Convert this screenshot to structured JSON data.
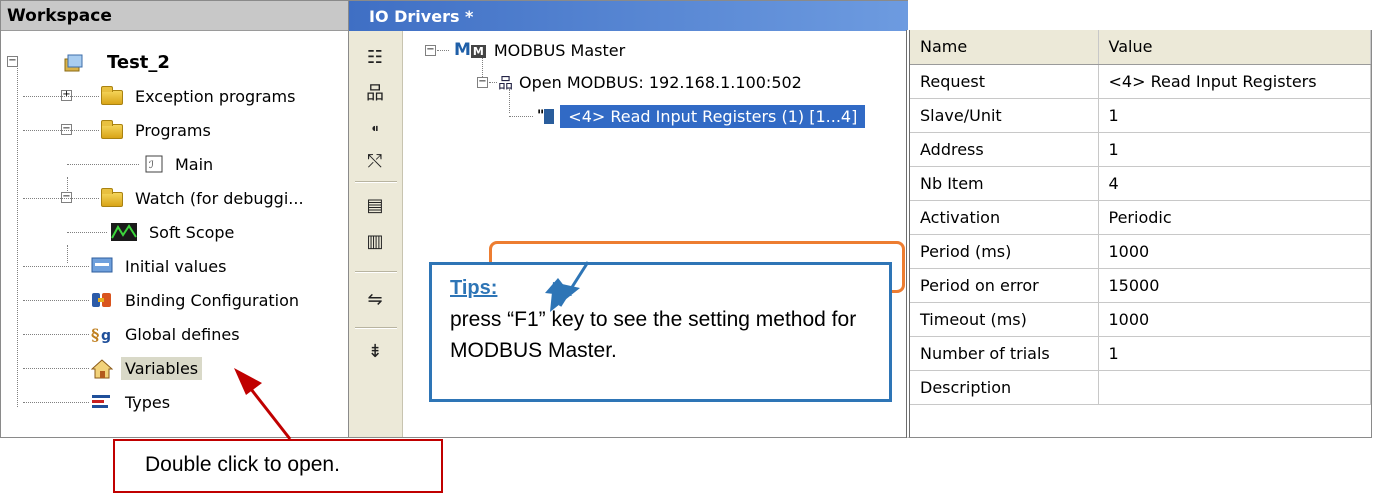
{
  "workspace": {
    "title": "Workspace",
    "project": "Test_2",
    "items": [
      {
        "label": "Exception programs",
        "icon": "folder-icon"
      },
      {
        "label": "Programs",
        "icon": "folder-icon"
      },
      {
        "label": "Main",
        "icon": "program-icon"
      },
      {
        "label": "Watch (for debuggi...",
        "icon": "folder-icon"
      },
      {
        "label": "Soft Scope",
        "icon": "scope-icon"
      },
      {
        "label": "Initial values",
        "icon": "initial-values-icon"
      },
      {
        "label": "Binding Configuration",
        "icon": "binding-icon"
      },
      {
        "label": "Global defines",
        "icon": "defines-icon"
      },
      {
        "label": "Variables",
        "icon": "house-icon"
      },
      {
        "label": "Types",
        "icon": "types-icon"
      }
    ]
  },
  "io": {
    "title": "IO Drivers *",
    "master": "MODBUS Master",
    "open": "Open MODBUS: 192.168.1.100:502",
    "request": "<4> Read Input Registers (1) [1...4]"
  },
  "props": {
    "header_name": "Name",
    "header_value": "Value",
    "rows": [
      {
        "name": "Request",
        "value": "<4> Read Input Registers"
      },
      {
        "name": "Slave/Unit",
        "value": "1"
      },
      {
        "name": "Address",
        "value": "1"
      },
      {
        "name": "Nb Item",
        "value": "4"
      },
      {
        "name": "Activation",
        "value": "Periodic"
      },
      {
        "name": "Period (ms)",
        "value": "1000"
      },
      {
        "name": "Period on error",
        "value": "15000"
      },
      {
        "name": "Timeout (ms)",
        "value": "1000"
      },
      {
        "name": "Number of trials",
        "value": "1"
      },
      {
        "name": "Description",
        "value": ""
      }
    ]
  },
  "callouts": {
    "tips_title": "Tips:",
    "tips_body": "press “F1” key to see the setting method for MODBUS Master.",
    "double_click": "Double click to open."
  },
  "colors": {
    "tips_border": "#2e75b6",
    "highlight": "#ed7d31",
    "arrow_red": "#c00000",
    "selection": "#316ac5"
  }
}
